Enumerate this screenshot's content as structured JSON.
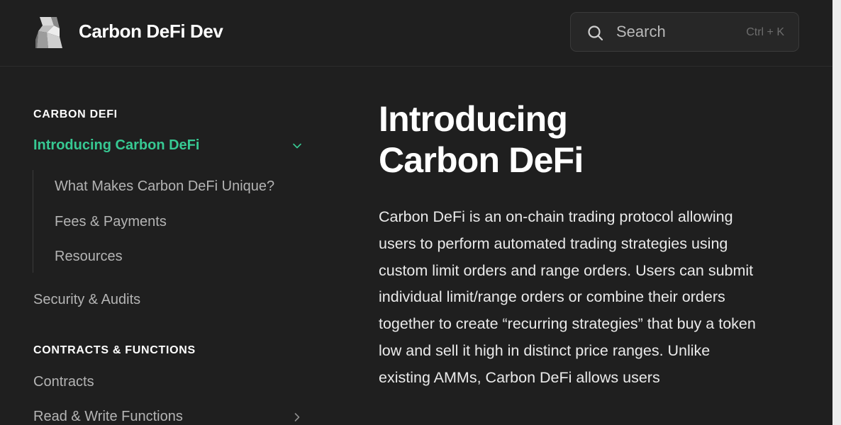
{
  "header": {
    "brand": "Carbon DeFi Dev",
    "search": {
      "placeholder": "Search",
      "shortcut": "Ctrl + K"
    }
  },
  "sidebar": {
    "sections": [
      {
        "title": "CARBON DEFI",
        "items": [
          {
            "label": "Introducing Carbon DeFi",
            "active": true,
            "expanded": true,
            "children": [
              {
                "label": "What Makes Carbon DeFi Unique?"
              },
              {
                "label": "Fees & Payments"
              },
              {
                "label": "Resources"
              }
            ]
          },
          {
            "label": "Security & Audits"
          }
        ]
      },
      {
        "title": "CONTRACTS & FUNCTIONS",
        "items": [
          {
            "label": "Contracts"
          },
          {
            "label": "Read & Write Functions",
            "expandable": true
          }
        ]
      }
    ]
  },
  "main": {
    "title": "Introducing Carbon DeFi",
    "paragraph": "Carbon DeFi is an on-chain trading protocol allowing users to perform automated trading strategies using custom limit orders and range orders. Users can submit individual limit/range orders or combine their orders together to create “recurring strategies” that buy a token low and sell it high in distinct price ranges. Unlike existing AMMs, Carbon DeFi allows users"
  },
  "colors": {
    "accent": "#37c993",
    "background": "#1f1f1f"
  }
}
